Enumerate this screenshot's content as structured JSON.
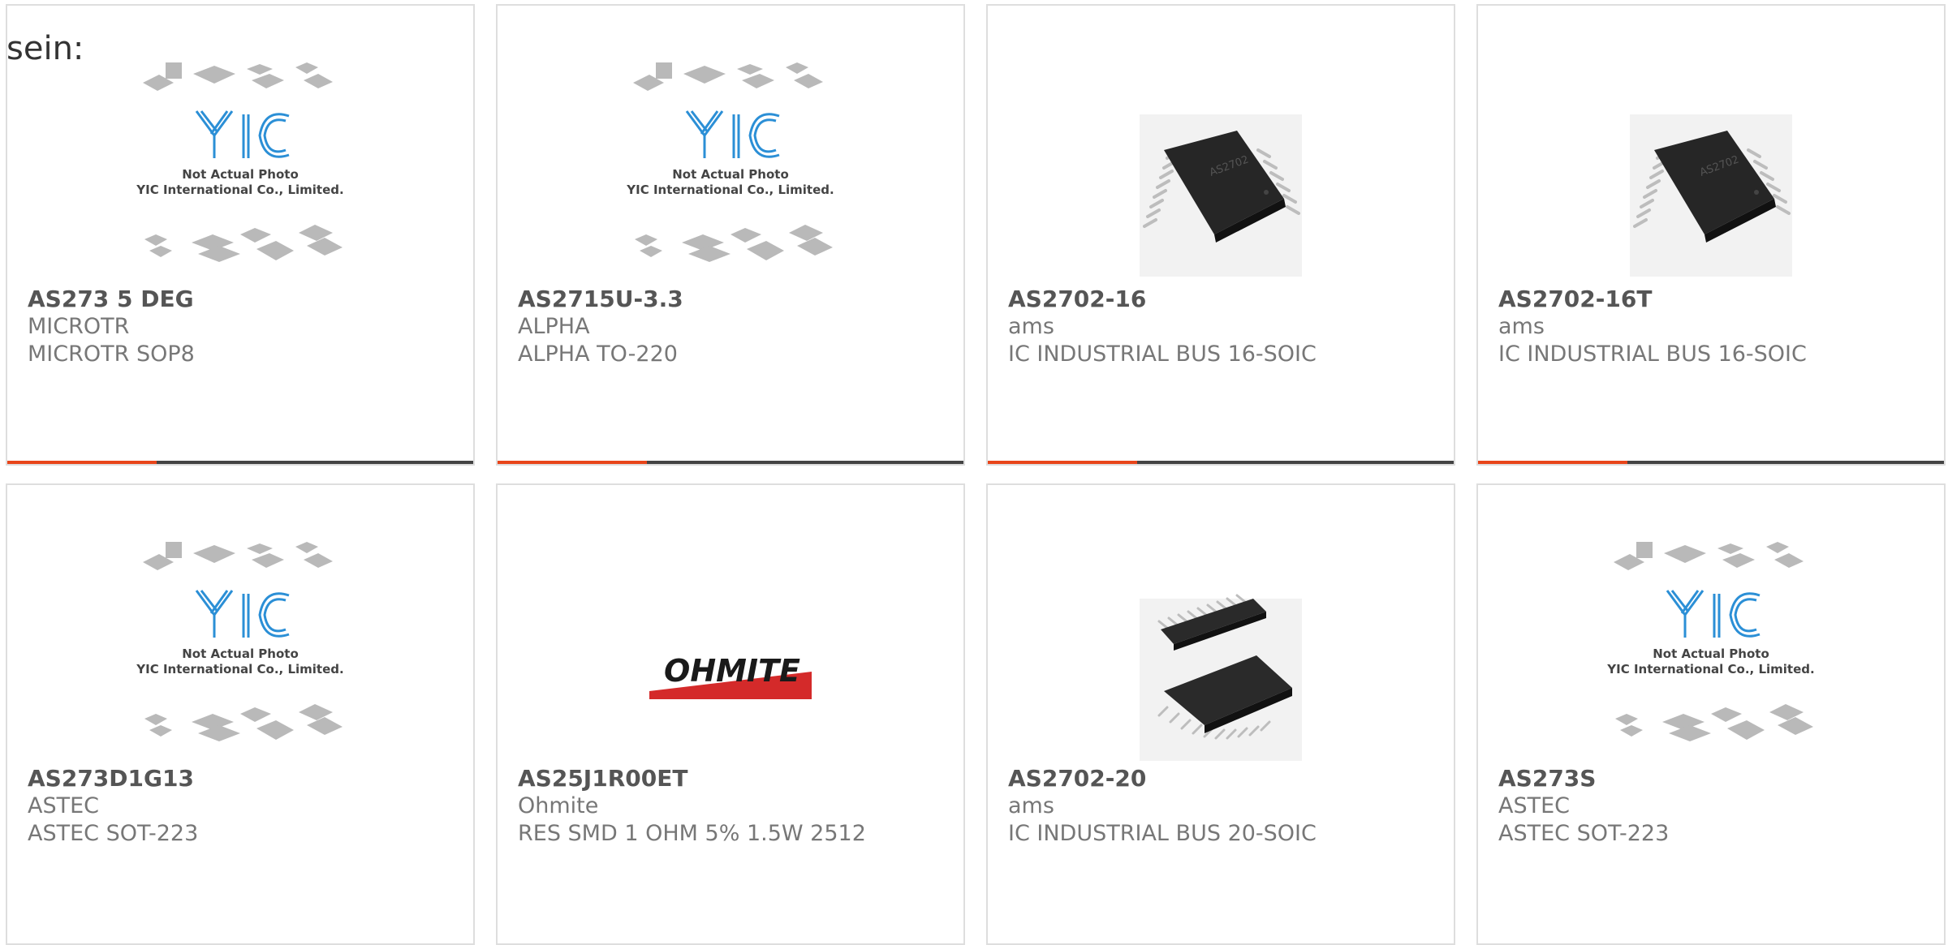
{
  "intro_text": "sein:",
  "placeholder": {
    "line1": "Not Actual Photo",
    "line2": "YIC International Co., Limited."
  },
  "ohmite_logo_text": "OHMITE",
  "colors": {
    "accent": "#e8451a",
    "bar_dark": "#444444",
    "border": "#dedede",
    "logo_blue": "#2b8fd6",
    "ohmite_red": "#d42a2a"
  },
  "products": [
    {
      "part": "AS273 5 DEG",
      "manufacturer": "MICROTR",
      "description": "MICROTR SOP8",
      "image": "yic-placeholder"
    },
    {
      "part": "AS2715U-3.3",
      "manufacturer": "ALPHA",
      "description": "ALPHA TO-220",
      "image": "yic-placeholder"
    },
    {
      "part": "AS2702-16",
      "manufacturer": "ams",
      "description": "IC INDUSTRIAL BUS 16-SOIC",
      "image": "soic-chip"
    },
    {
      "part": "AS2702-16T",
      "manufacturer": "ams",
      "description": "IC INDUSTRIAL BUS 16-SOIC",
      "image": "soic-chip"
    },
    {
      "part": "AS273D1G13",
      "manufacturer": "ASTEC",
      "description": "ASTEC SOT-223",
      "image": "yic-placeholder"
    },
    {
      "part": "AS25J1R00ET",
      "manufacturer": "Ohmite",
      "description": "RES SMD 1 OHM 5% 1.5W 2512",
      "image": "ohmite-logo"
    },
    {
      "part": "AS2702-20",
      "manufacturer": "ams",
      "description": "IC INDUSTRIAL BUS 20-SOIC",
      "image": "soic-chip-pair"
    },
    {
      "part": "AS273S",
      "manufacturer": "ASTEC",
      "description": "ASTEC SOT-223",
      "image": "yic-placeholder"
    }
  ]
}
